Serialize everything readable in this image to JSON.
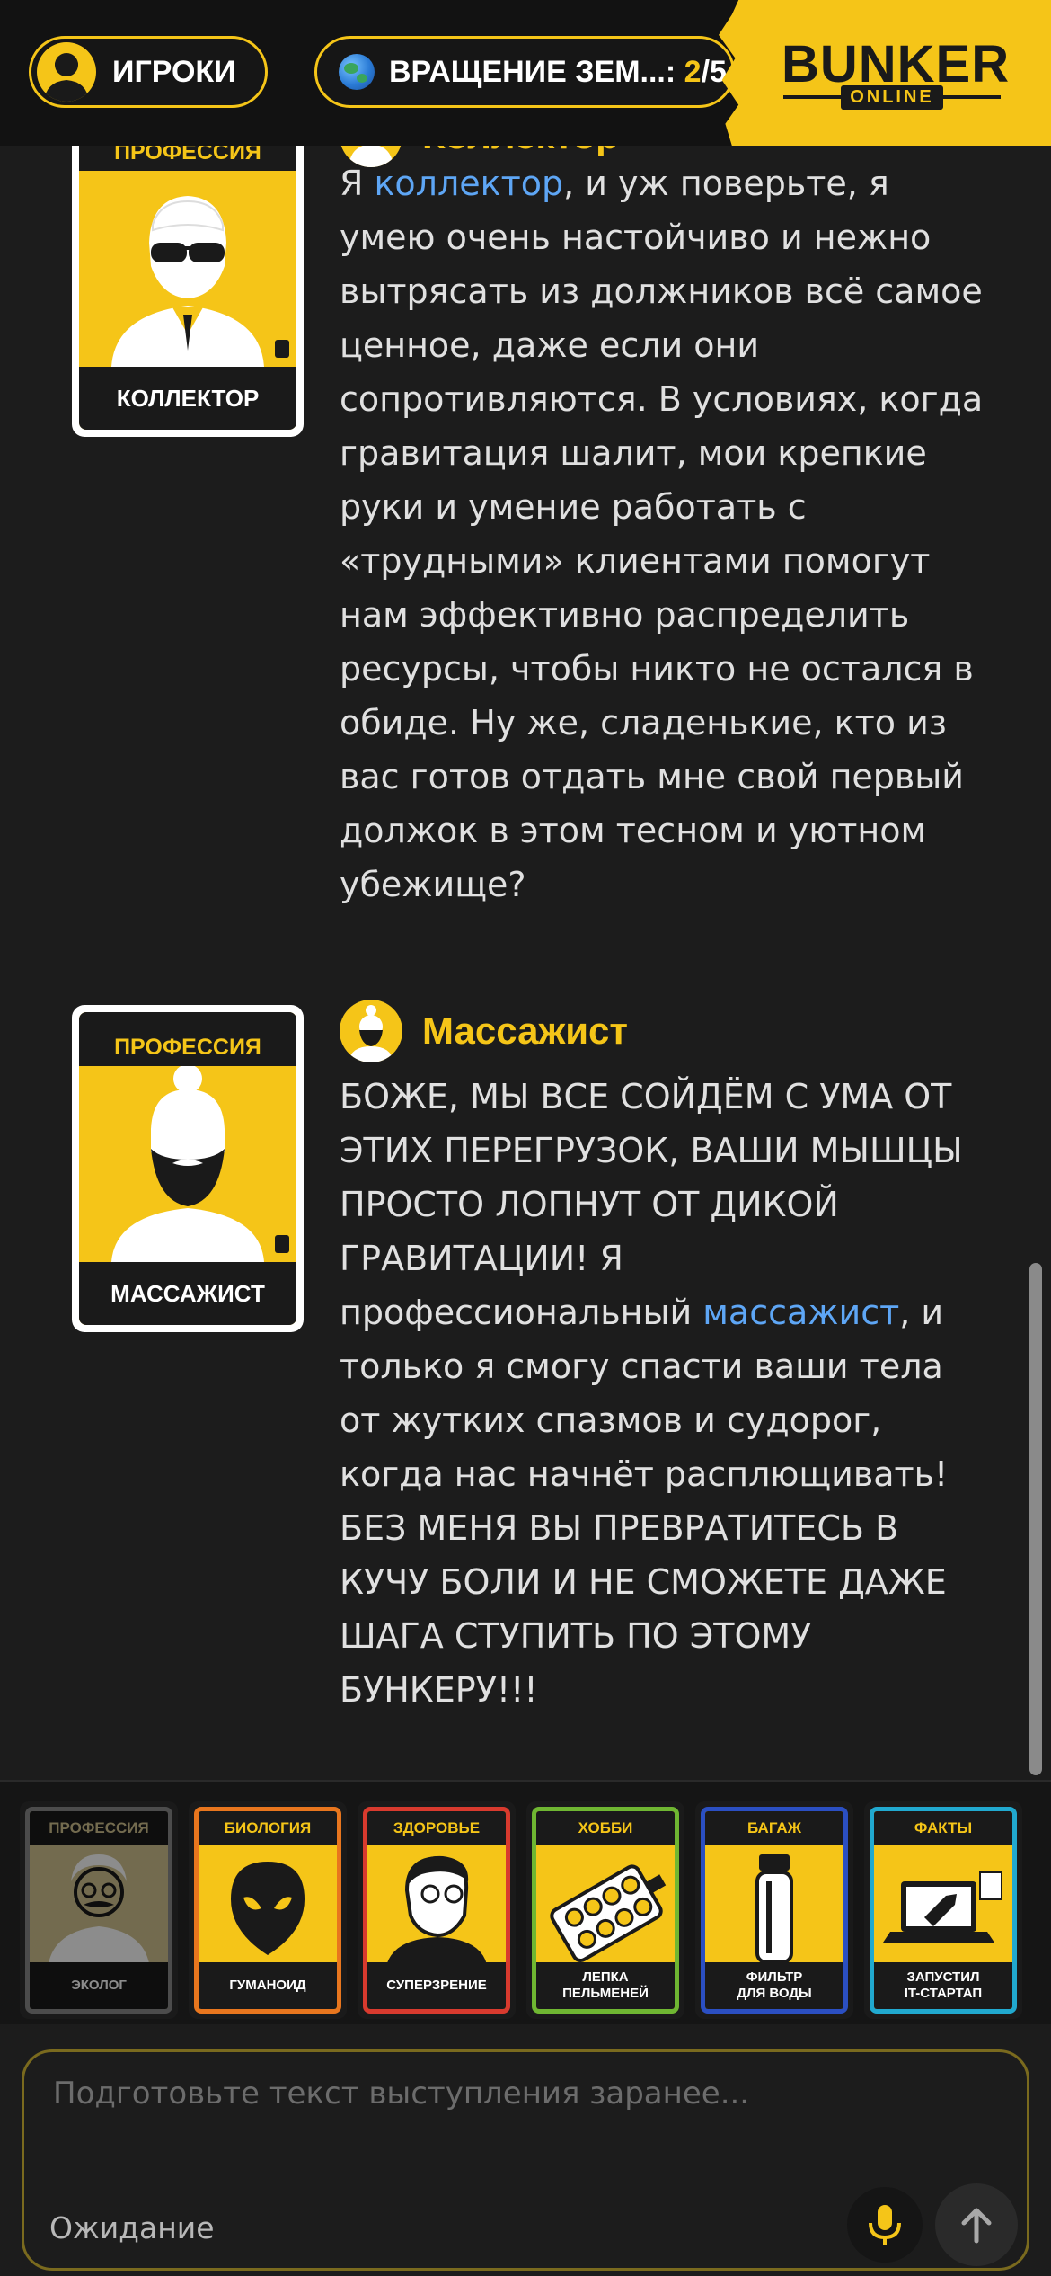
{
  "header": {
    "players_label": "ИГРОКИ",
    "round_label": "ВРАЩЕНИЕ ЗЕМ...: ",
    "round_current": "2",
    "round_sep": "/5",
    "logo_main": "BUNKER",
    "logo_sub": "ONLINE"
  },
  "messages": [
    {
      "card_category": "ПРОФЕССИЯ",
      "card_title": "КОЛЛЕКТОР",
      "author": "Коллектор",
      "text_before": "Я ",
      "highlight": "коллектор",
      "text_after": ", и уж поверьте, я умею очень настойчиво и нежно вытрясать из должников всё самое ценное, даже если они сопротивляются. В условиях, когда гравитация шалит, мои крепкие руки и умение работать с «трудными» клиентами помогут нам эффективно распределить ресурсы, чтобы никто не остался в обиде. Ну же, сладенькие, кто из вас готов отдать мне свой первый должок в этом тесном и уютном убежище?"
    },
    {
      "card_category": "ПРОФЕССИЯ",
      "card_title": "МАССАЖИСТ",
      "author": "Массажист",
      "text_before": "БОЖЕ, МЫ ВСЕ СОЙДЁМ С УМА ОТ ЭТИХ ПЕРЕГРУЗОК, ВАШИ МЫШЦЫ ПРОСТО ЛОПНУТ ОТ ДИКОЙ ГРАВИТАЦИИ! Я профессиональный ",
      "highlight": "массажист",
      "text_after": ", и только я смогу спасти ваши тела от жутких спазмов и судорог, когда нас начнёт расплющивать! БЕЗ МЕНЯ ВЫ ПРЕВРАТИТЕСЬ В КУЧУ БОЛИ И НЕ СМОЖЕТЕ ДАЖЕ ШАГА СТУПИТЬ ПО ЭТОМУ БУНКЕРУ!!!"
    }
  ],
  "tray": [
    {
      "category": "ПРОФЕССИЯ",
      "title": "ЭКОЛОГ",
      "border": "#8a8a8a",
      "icon": "ecologist-icon"
    },
    {
      "category": "БИОЛОГИЯ",
      "title": "ГУМАНОИД",
      "border": "#e8761e",
      "icon": "alien-icon"
    },
    {
      "category": "ЗДОРОВЬЕ",
      "title": "СУПЕРЗРЕНИЕ",
      "border": "#d83a2e",
      "icon": "glasses-person-icon"
    },
    {
      "category": "ХОББИ",
      "title": "ЛЕПКА\nПЕЛЬМЕНЕЙ",
      "border": "#6fb632",
      "icon": "dumpling-board-icon"
    },
    {
      "category": "БАГАЖ",
      "title": "ФИЛЬТР\nДЛЯ ВОДЫ",
      "border": "#2b4fc2",
      "icon": "water-filter-icon"
    },
    {
      "category": "ФАКТЫ",
      "title": "ЗАПУСТИЛ\nIT-СТАРТАП",
      "border": "#21a9cf",
      "icon": "laptop-rocket-icon"
    }
  ],
  "composer": {
    "placeholder": "Подготовьте текст выступления заранее...",
    "status": "Ожидание"
  },
  "colors": {
    "accent": "#f5c518",
    "link": "#5ea6f5",
    "background": "#1c1c1c"
  }
}
